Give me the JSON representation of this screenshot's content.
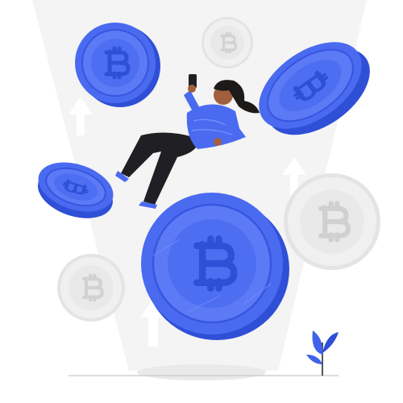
{
  "scene": {
    "subject": "woman-floating-among-bitcoins",
    "colors": {
      "coin_blue": "#4a6af0",
      "coin_blue_dark": "#2f4fd6",
      "coin_blue_light": "#7a92ff",
      "coin_gray": "#ececec",
      "coin_gray_edge": "#d7d7d7",
      "beam": "#f4f4f4",
      "skin": "#a0603d",
      "hair": "#1e1a1a",
      "pants": "#1f1f24",
      "shirt": "#4a6af0",
      "ground": "#e6e6e6",
      "plant": "#3f63ea"
    },
    "icons": [
      "bitcoin-icon",
      "arrow-up-icon",
      "phone-icon",
      "plant-icon"
    ]
  }
}
